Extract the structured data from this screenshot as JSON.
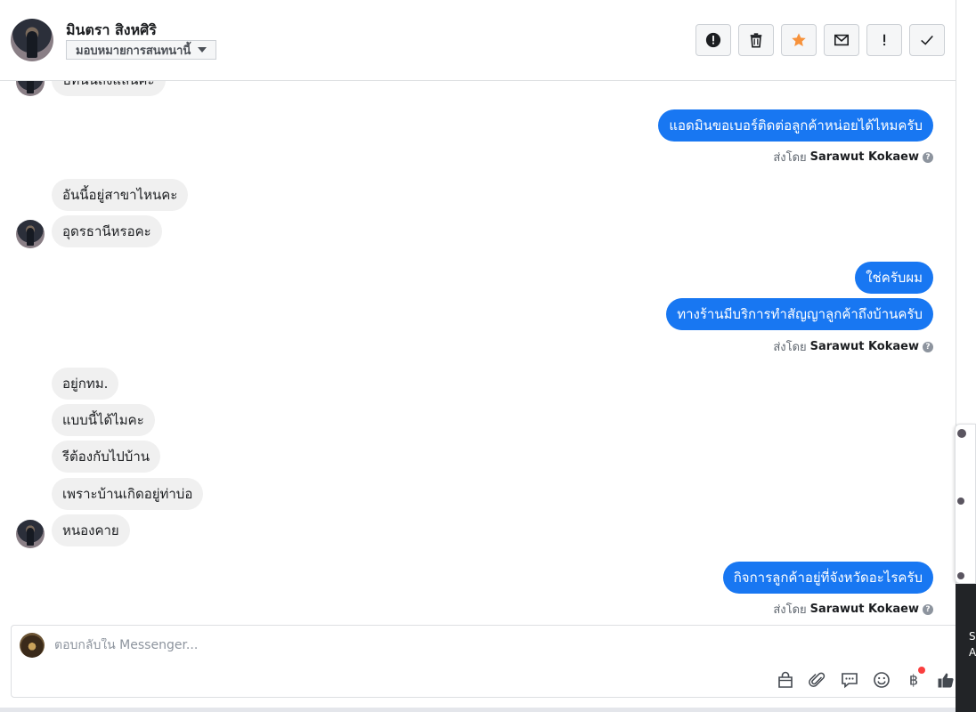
{
  "header": {
    "contact_name": "มินตรา สิงหศิริ",
    "assign_label": "มอบหมายการสนทนานี้",
    "toolbar": [
      "spam-icon",
      "trash-icon",
      "star-icon",
      "envelope-icon",
      "exclamation-icon",
      "check-icon"
    ],
    "accent_star": "#f7923b"
  },
  "messages": {
    "partial_top": "บทนนถงแลนคะ",
    "m1": "แอดมินขอเบอร์ติดต่อลูกค้าหน่อยได้ไหมครับ",
    "m2": "อันนี้อยู่สาขาไหนคะ",
    "m3": "อุดรธานีหรอคะ",
    "m4": "ใช่ครับผม",
    "m5": "ทางร้านมีบริการทำสัญญาลูกค้าถึงบ้านครับ",
    "m6": "อยู่กทม.",
    "m7": "แบบนี้ได้ไมคะ",
    "m8": "รีต้องกับไปบ้าน",
    "m9": "เพราะบ้านเกิดอยู่ท่าบ่อ",
    "m10": "หนองคาย",
    "m11": "กิจการลูกค้าอยู่ที่จังหวัดอะไรครับ"
  },
  "sent_by": {
    "prefix": "ส่งโดย",
    "name": "Sarawut Kokaew"
  },
  "composer": {
    "placeholder": "ตอบกลับใน Messenger...",
    "tools": [
      "bag-icon",
      "paperclip-icon",
      "saved-reply-icon",
      "emoji-icon",
      "baht-icon",
      "thumbs-up-icon"
    ],
    "brand_color": "#1877f2"
  },
  "side": {
    "text_1": "S",
    "text_2": "A"
  }
}
